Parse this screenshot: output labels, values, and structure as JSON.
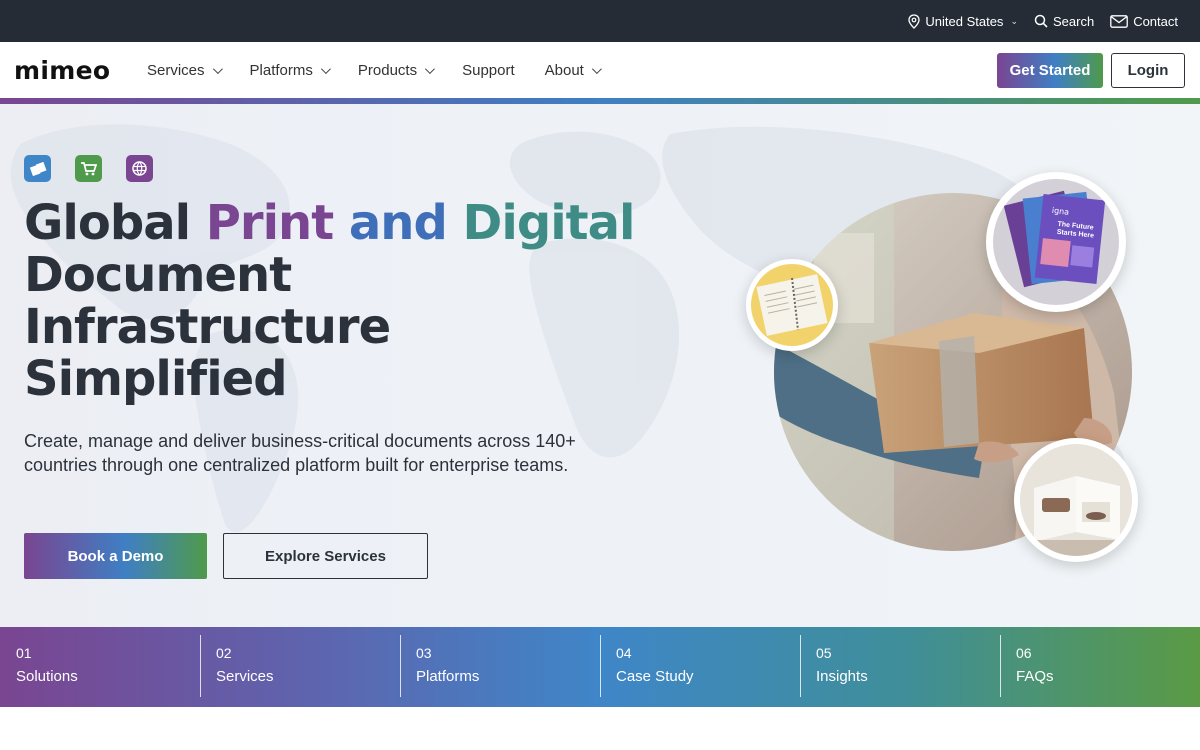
{
  "utility": {
    "region_label": "United States",
    "search_label": "Search",
    "contact_label": "Contact"
  },
  "nav": {
    "logo": "mimeo",
    "items": [
      {
        "label": "Services",
        "has_dropdown": true
      },
      {
        "label": "Platforms",
        "has_dropdown": true
      },
      {
        "label": "Products",
        "has_dropdown": true
      },
      {
        "label": "Support",
        "has_dropdown": false
      },
      {
        "label": "About",
        "has_dropdown": true
      }
    ],
    "get_started_label": "Get Started",
    "login_label": "Login"
  },
  "hero": {
    "category_icons": [
      "documents-icon",
      "cart-icon",
      "globe-icon"
    ],
    "headline": {
      "part1": "Global ",
      "part2": "Print",
      "part3": "and",
      "part4": "Digital",
      "line2": "Document",
      "line3": "Infrastructure",
      "line4": "Simplified"
    },
    "subheadline": "Create, manage and deliver business-critical documents across 140+ countries through one centralized platform built for enterprise teams.",
    "primary_cta": "Book a Demo",
    "secondary_cta": "Explore Services",
    "brochure_text": {
      "brand": "igna",
      "title": "The Future Starts Here"
    }
  },
  "section_tabs": [
    {
      "num": "01",
      "label": "Solutions"
    },
    {
      "num": "02",
      "label": "Services"
    },
    {
      "num": "03",
      "label": "Platforms"
    },
    {
      "num": "04",
      "label": "Case Study"
    },
    {
      "num": "05",
      "label": "Insights"
    },
    {
      "num": "06",
      "label": "FAQs"
    }
  ],
  "colors": {
    "brand_purple": "#7a4591",
    "brand_blue": "#3f7fc4",
    "brand_green": "#4f9a4b",
    "dark": "#262c36"
  }
}
